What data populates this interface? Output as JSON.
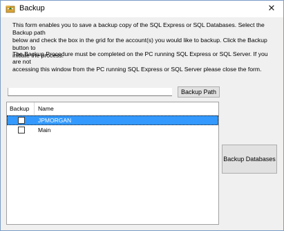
{
  "window": {
    "title": "Backup",
    "close_glyph": "✕",
    "icon": "backup-app-icon"
  },
  "description": {
    "para1_line1": "This form enables you to save a backup copy of the SQL Express or SQL Databases.  Select the Backup path",
    "para1_line2": "below and check the box in the grid for the account(s) you would like to backup.  Click the Backup button to",
    "para1_line3": "initiate the process.",
    "para2_line1": "The Backup Procedure must be completed on the PC running SQL Express or SQL Server.  If you are not",
    "para2_line2": "accessing this window from the PC running SQL Express or SQL Server please close the form."
  },
  "backup_path": {
    "value": "",
    "button_label": "Backup Path"
  },
  "grid": {
    "columns": [
      "Backup",
      "Name"
    ],
    "rows": [
      {
        "checked": false,
        "name": "JPMORGAN",
        "selected": true
      },
      {
        "checked": false,
        "name": "Main",
        "selected": false
      }
    ]
  },
  "actions": {
    "backup_label": "Backup Databases"
  },
  "colors": {
    "selection": "#3399ff",
    "window_bg": "#f0f0f0"
  }
}
